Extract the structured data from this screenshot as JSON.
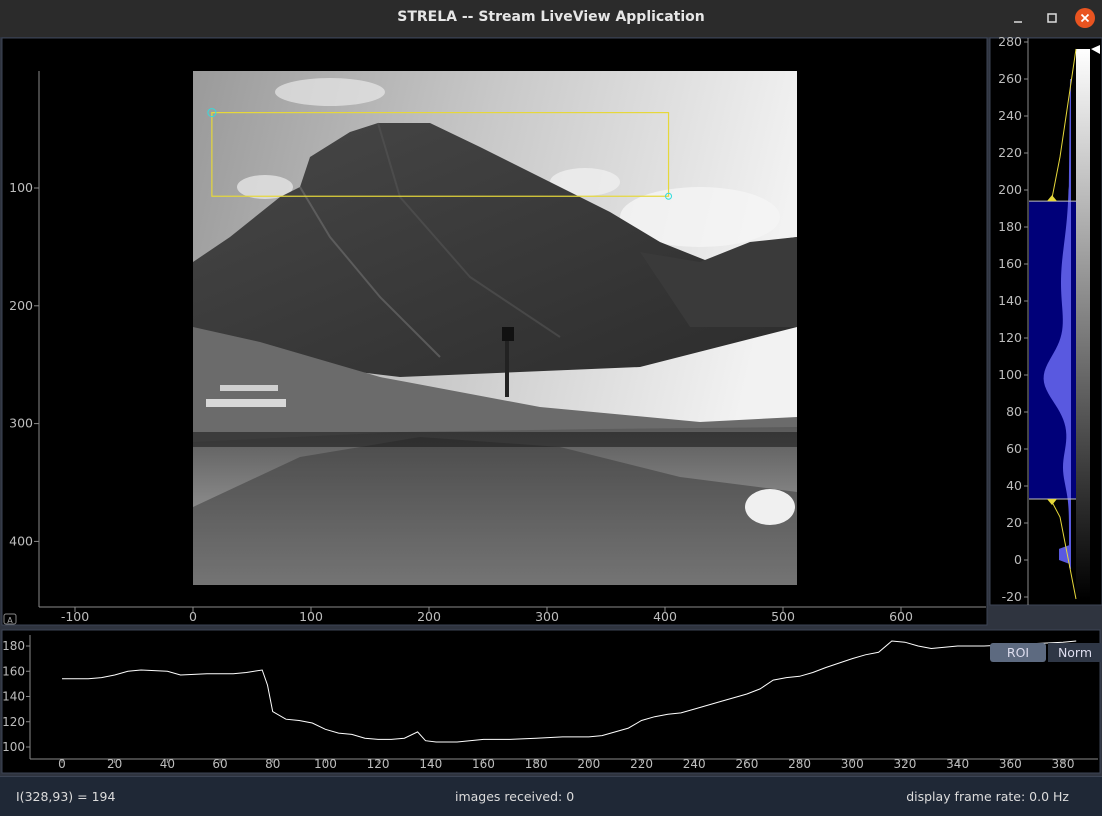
{
  "window": {
    "title": "STRELA -- Stream LiveView Application",
    "minimize_glyph": "–",
    "maximize_glyph": "☐",
    "close_glyph": "✕"
  },
  "image_view": {
    "x_ticks": [
      "-100",
      "0",
      "100",
      "200",
      "300",
      "400",
      "500",
      "600"
    ],
    "y_ticks": [
      "100",
      "200",
      "300",
      "400"
    ],
    "auto_range_glyph": "A",
    "roi_image_coords": [
      16,
      36,
      403,
      107
    ]
  },
  "histogram": {
    "y_ticks": [
      "280",
      "260",
      "240",
      "220",
      "200",
      "180",
      "160",
      "140",
      "120",
      "100",
      "80",
      "60",
      "40",
      "20",
      "0",
      "-20"
    ],
    "level_min": 33,
    "level_max": 194,
    "buttons": {
      "roi": "ROI",
      "norm": "Norm"
    }
  },
  "profile": {
    "x_ticks": [
      "0",
      "20",
      "40",
      "60",
      "80",
      "100",
      "120",
      "140",
      "160",
      "180",
      "200",
      "220",
      "240",
      "260",
      "280",
      "300",
      "320",
      "340",
      "360",
      "380"
    ],
    "y_ticks": [
      "180",
      "160",
      "140",
      "120",
      "100"
    ],
    "series": [
      [
        0,
        154
      ],
      [
        10,
        154
      ],
      [
        15,
        155
      ],
      [
        20,
        157
      ],
      [
        25,
        160
      ],
      [
        30,
        161
      ],
      [
        40,
        160
      ],
      [
        45,
        157
      ],
      [
        55,
        158
      ],
      [
        65,
        158
      ],
      [
        70,
        159
      ],
      [
        76,
        161
      ],
      [
        78,
        149
      ],
      [
        80,
        128
      ],
      [
        85,
        122
      ],
      [
        90,
        121
      ],
      [
        95,
        119
      ],
      [
        100,
        114
      ],
      [
        105,
        111
      ],
      [
        110,
        110
      ],
      [
        115,
        107
      ],
      [
        120,
        106
      ],
      [
        125,
        106
      ],
      [
        130,
        107
      ],
      [
        135,
        112
      ],
      [
        138,
        105
      ],
      [
        142,
        104
      ],
      [
        150,
        104
      ],
      [
        160,
        106
      ],
      [
        170,
        106
      ],
      [
        180,
        107
      ],
      [
        190,
        108
      ],
      [
        195,
        108
      ],
      [
        200,
        108
      ],
      [
        205,
        109
      ],
      [
        210,
        112
      ],
      [
        215,
        115
      ],
      [
        220,
        121
      ],
      [
        225,
        124
      ],
      [
        230,
        126
      ],
      [
        235,
        127
      ],
      [
        240,
        130
      ],
      [
        250,
        136
      ],
      [
        260,
        142
      ],
      [
        265,
        146
      ],
      [
        270,
        153
      ],
      [
        275,
        155
      ],
      [
        280,
        156
      ],
      [
        285,
        159
      ],
      [
        290,
        163
      ],
      [
        300,
        170
      ],
      [
        305,
        173
      ],
      [
        310,
        175
      ],
      [
        315,
        184
      ],
      [
        320,
        183
      ],
      [
        325,
        180
      ],
      [
        330,
        178
      ],
      [
        335,
        179
      ],
      [
        340,
        180
      ],
      [
        345,
        180
      ],
      [
        350,
        180
      ],
      [
        360,
        181
      ],
      [
        370,
        182
      ],
      [
        380,
        183
      ],
      [
        385,
        184
      ]
    ]
  },
  "status": {
    "pixel": "I(328,93) = 194",
    "images": "images received: 0",
    "fps": "display frame rate: 0.0 Hz"
  }
}
